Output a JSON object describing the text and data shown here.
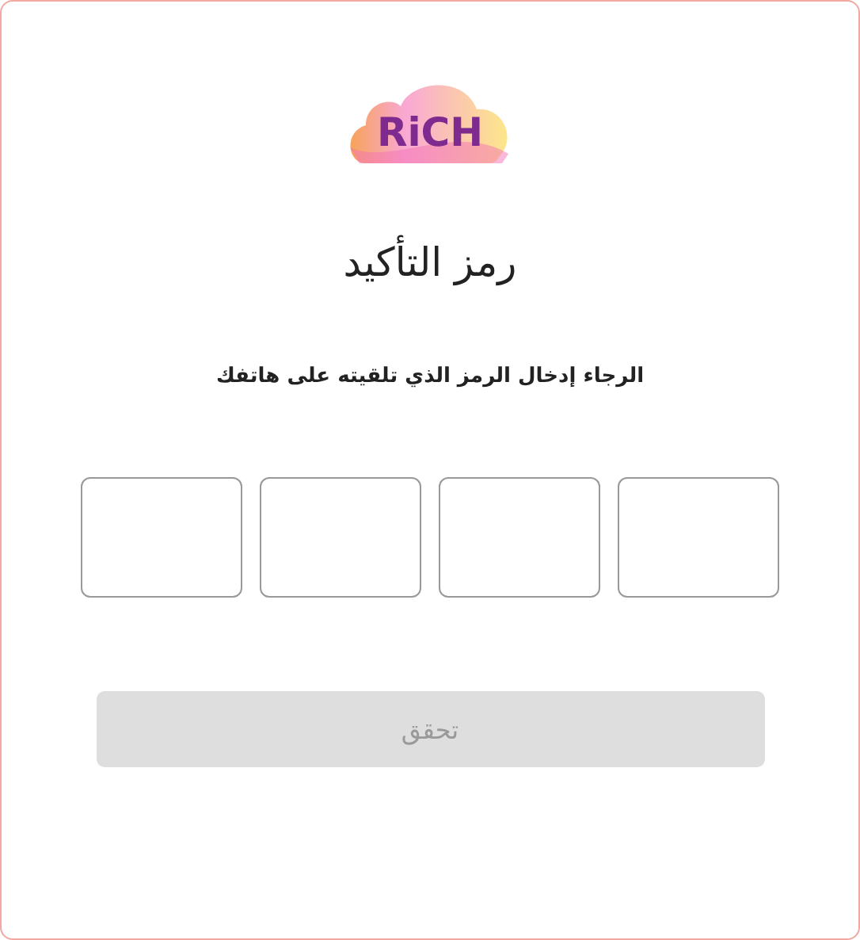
{
  "logo": {
    "text": "RiCH"
  },
  "title": "رمز التأكيد",
  "instruction": "الرجاء إدخال الرمز الذي تلقيته على هاتفك",
  "code_fields": [
    {
      "focused": false
    },
    {
      "focused": false
    },
    {
      "focused": false
    },
    {
      "focused": false
    }
  ],
  "verify_button": {
    "label": "تحقق",
    "disabled": true
  }
}
